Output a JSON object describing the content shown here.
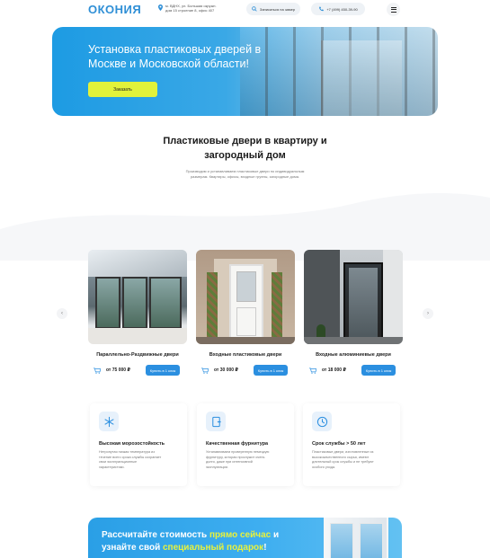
{
  "header": {
    "logo": "ОКОНИЯ",
    "address_line1": "м. ВДНХ, ул. Большая окружн.",
    "address_line2": "дом 15 строение 8, офис 407",
    "call_label": "Записаться на замер",
    "phone_label": "+7 (499) 450-39-90"
  },
  "hero": {
    "title_line1": "Установка пластиковых дверей в",
    "title_line2": "Москве и Московской области!",
    "order_button": "Заказать"
  },
  "section": {
    "title_line1": "Пластиковые двери в квартиру и",
    "title_line2": "загородный дом",
    "desc_line1": "Производим и устанавливаем пластиковые двери по индивидуальным",
    "desc_line2": "размерам. Квартиры, офисы, входные группы, загородные дома."
  },
  "products": [
    {
      "name": "Параллельно-Раздвижные двери",
      "price": "от 75 000 ₽",
      "button": "Купить в 1 клик"
    },
    {
      "name": "Входные пластиковые двери",
      "price": "от 30 000 ₽",
      "button": "Купить в 1 клик"
    },
    {
      "name": "Входные алюминиевые двери",
      "price": "от 18 000 ₽",
      "button": "Купить в 1 клик"
    }
  ],
  "features": [
    {
      "title": "Высокая морозостойкость",
      "text_line1": "Нетронутая низкая температура из",
      "text_line2": "течение всего срока службы сохраняет",
      "text_line3": "свои эксплуатационные",
      "text_line4": "характеристики."
    },
    {
      "title": "Качественная фурнитура",
      "text_line1": "Устанавливаем проверенную немецкую",
      "text_line2": "фурнитуру, которая прослужит очень",
      "text_line3": "долго, даже при интенсивной",
      "text_line4": "эксплуатации."
    },
    {
      "title": "Срок службы > 50 лет",
      "text_line1": "Пластиковые двери, изготовленные из",
      "text_line2": "высококачественного сырья, имеют",
      "text_line3": "длительный срок службы и не требуют",
      "text_line4": "особого ухода."
    }
  ],
  "promo": {
    "part1": "Рассчитайте стоимость ",
    "highlight1": "прямо сейчас",
    "part2": " и",
    "part3": "узнайте свой ",
    "highlight2": "специальный подарок",
    "part4": "!"
  },
  "colors": {
    "brand_blue": "#2f8fd6",
    "button_blue": "#2b8fe0",
    "accent_yellow": "#e2f23a"
  },
  "icons": {
    "address": "map-pin-icon",
    "call": "search-icon",
    "phone": "phone-icon",
    "menu": "hamburger-icon",
    "cart": "cart-icon",
    "prev": "chevron-left-icon",
    "next": "chevron-right-icon",
    "frost": "snowflake-icon",
    "hardware": "door-handle-icon",
    "lifetime": "clock-icon"
  }
}
